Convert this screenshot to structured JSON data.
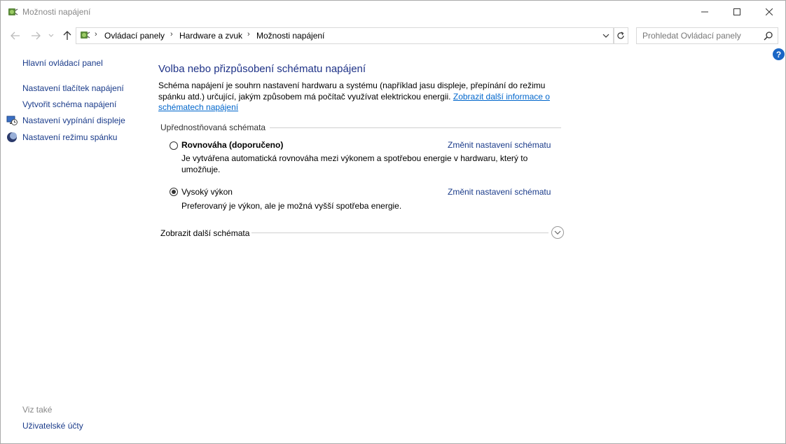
{
  "window": {
    "title": "Možnosti napájení"
  },
  "addressbar": {
    "crumbs": [
      "Ovládací panely",
      "Hardware a zvuk",
      "Možnosti napájení"
    ]
  },
  "search": {
    "placeholder": "Prohledat Ovládací panely"
  },
  "sidebar": {
    "home": "Hlavní ovládací panel",
    "items": [
      {
        "label": "Nastavení tlačítek napájení",
        "icon": "none"
      },
      {
        "label": "Vytvořit schéma napájení",
        "icon": "none"
      },
      {
        "label": "Nastavení vypínání displeje",
        "icon": "display-clock-icon"
      },
      {
        "label": "Nastavení režimu spánku",
        "icon": "moon-icon"
      }
    ],
    "see_also_title": "Viz také",
    "see_also": [
      "Uživatelské účty"
    ]
  },
  "main": {
    "title": "Volba nebo přizpůsobení schématu napájení",
    "description": "Schéma napájení je souhrn nastavení hardwaru a systému (například jasu displeje, přepínání do režimu spánku atd.) určující, jakým způsobem má počítač využívat elektrickou energii. ",
    "description_link": "Zobrazit další informace o schématech napájení",
    "preferred_label": "Upřednostňovaná schémata",
    "plans": [
      {
        "name": "Rovnováha (doporučeno)",
        "selected": false,
        "description": "Je vytvářena automatická rovnováha mezi výkonem a spotřebou energie v hardwaru, který to umožňuje.",
        "link": "Změnit nastavení schématu"
      },
      {
        "name": "Vysoký výkon",
        "selected": true,
        "description": "Preferovaný je výkon, ale je možná vyšší spotřeba energie.",
        "link": "Změnit nastavení schématu"
      }
    ],
    "more_label": "Zobrazit další schémata"
  },
  "colors": {
    "link": "#1a3b8a",
    "title": "#1e3287",
    "hyperlink": "#0066cc",
    "help": "#1a66c5"
  }
}
